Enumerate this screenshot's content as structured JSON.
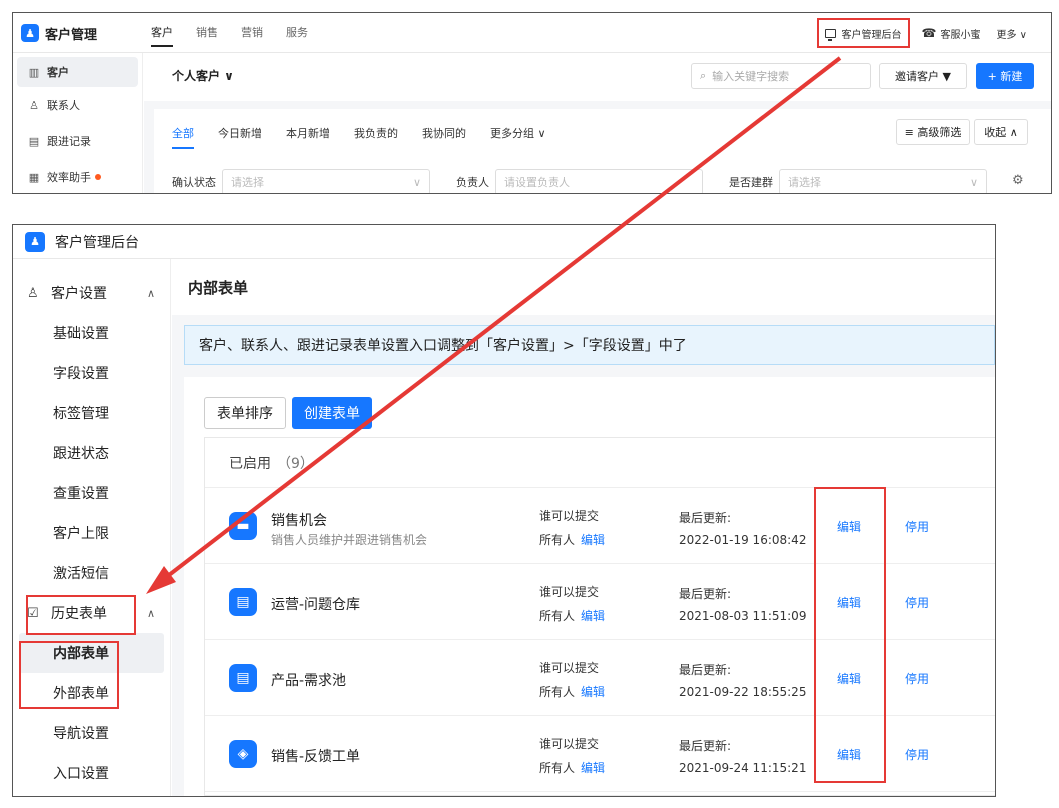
{
  "top": {
    "brand": "客户管理",
    "brand_badge": "♟",
    "tabs": [
      "客户",
      "销售",
      "营销",
      "服务"
    ],
    "admin_link": "客户管理后台",
    "service": "客服小蜜",
    "service_icon": "☎",
    "more": "更多 ∨",
    "sidebar": [
      {
        "icon": "▥",
        "label": "客户"
      },
      {
        "icon": "♙",
        "label": "联系人"
      },
      {
        "icon": "▤",
        "label": "跟进记录"
      },
      {
        "icon": "▦",
        "label": "效率助手"
      }
    ],
    "page_title": "个人客户 ∨",
    "search_placeholder": "输入关键字搜索",
    "invite_label": "邀请客户 ▼",
    "new_label": "+ 新建",
    "filters": [
      "全部",
      "今日新增",
      "本月新增",
      "我负责的",
      "我协同的",
      "更多分组 ∨"
    ],
    "advanced_filter": "≡ 高级筛选",
    "collapse": "收起 ∧",
    "fields": [
      {
        "label": "确认状态",
        "placeholder": "请选择"
      },
      {
        "label": "负责人",
        "placeholder": "请设置负责人"
      },
      {
        "label": "是否建群",
        "placeholder": "请选择"
      }
    ],
    "gear_icon": "⚙"
  },
  "bottom": {
    "title": "客户管理后台",
    "sidebar": {
      "group1": {
        "icon": "♙",
        "label": "客户设置",
        "chevron": "∧"
      },
      "group1_items": [
        "基础设置",
        "字段设置",
        "标签管理",
        "跟进状态",
        "查重设置",
        "客户上限",
        "激活短信"
      ],
      "group2": {
        "icon": "☑",
        "label": "历史表单",
        "chevron": "∧"
      },
      "group2_items": [
        "内部表单",
        "外部表单",
        "导航设置",
        "入口设置"
      ]
    },
    "page_title": "内部表单",
    "notice": "客户、联系人、跟进记录表单设置入口调整到「客户设置」>「字段设置」中了",
    "sort_button": "表单排序",
    "create_button": "创建表单",
    "enabled_label": "已启用",
    "enabled_count": "（9）",
    "who_label": "谁可以提交",
    "who_value": "所有人",
    "who_edit": "编辑",
    "updated_label": "最后更新:",
    "edit_label": "编辑",
    "stop_label": "停用",
    "rows": [
      {
        "icon": "▬",
        "name": "销售机会",
        "desc": "销售人员维护并跟进销售机会",
        "updated": "2022-01-19 16:08:42"
      },
      {
        "icon": "▤",
        "name": "运营-问题仓库",
        "desc": "",
        "updated": "2021-08-03 11:51:09"
      },
      {
        "icon": "▤",
        "name": "产品-需求池",
        "desc": "",
        "updated": "2021-09-22 18:55:25"
      },
      {
        "icon": "◈",
        "name": "销售-反馈工单",
        "desc": "",
        "updated": "2021-09-24 11:15:21"
      }
    ]
  },
  "colors": {
    "accent": "#1677ff",
    "highlight": "#e53935"
  }
}
